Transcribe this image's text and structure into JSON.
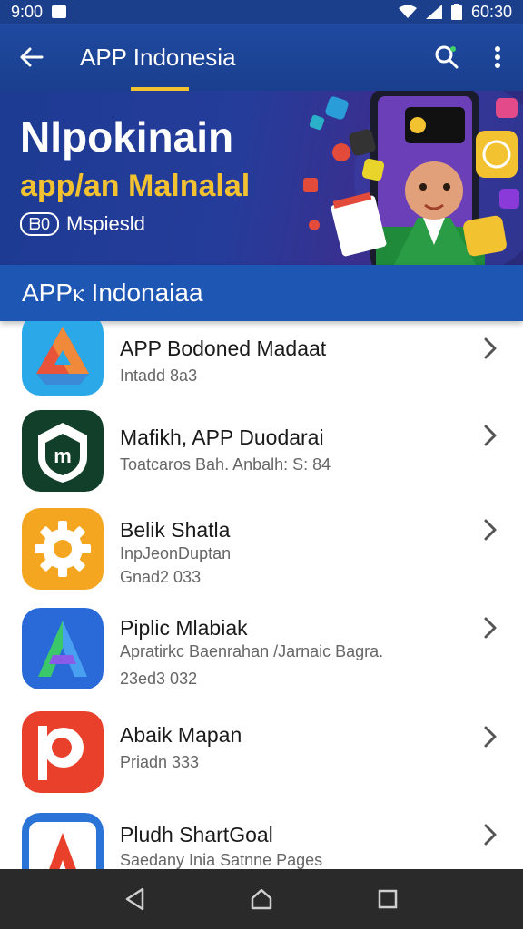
{
  "status_bar": {
    "time": "9:00",
    "right_text": "60:30"
  },
  "app_bar": {
    "title": "APP Indonesia"
  },
  "banner": {
    "title": "Nlpokinain",
    "subtitle": "app/an Malnalal",
    "tag_badge": "ᗷ0",
    "tag_text": "Mspiesld"
  },
  "section": {
    "title": "APPⲕ Indonaiaa"
  },
  "apps": [
    {
      "title": "APP Bodoned Madaat",
      "lines": [
        "Intadd 8a3"
      ],
      "icon": "drive-triangle-icon"
    },
    {
      "title": "Mafikh, APP Duodarai",
      "lines": [
        "Toatcaros Bah. Anbalh: S: 84"
      ],
      "icon": "shield-m-icon"
    },
    {
      "title": "Belik Shatla",
      "lines": [
        "InpJeonDuptan",
        "Gnad2 033"
      ],
      "icon": "gear-icon"
    },
    {
      "title": "Piplic Mlabiak",
      "lines": [
        "Apratirkc Baenrahan /Jarnaic Bagra.",
        "23ed3 032"
      ],
      "icon": "a-logo-icon"
    },
    {
      "title": "Abaik Mapan",
      "lines": [
        "Priadn 333"
      ],
      "icon": "p-logo-icon"
    },
    {
      "title": "Pludh ShartGoal",
      "lines": [
        "Saedany Inia Satnne Pages"
      ],
      "icon": "a-red-logo-icon"
    }
  ],
  "colors": {
    "primary": "#1e56b3",
    "accent": "#f2c230",
    "nav": "#2a2a2a"
  }
}
